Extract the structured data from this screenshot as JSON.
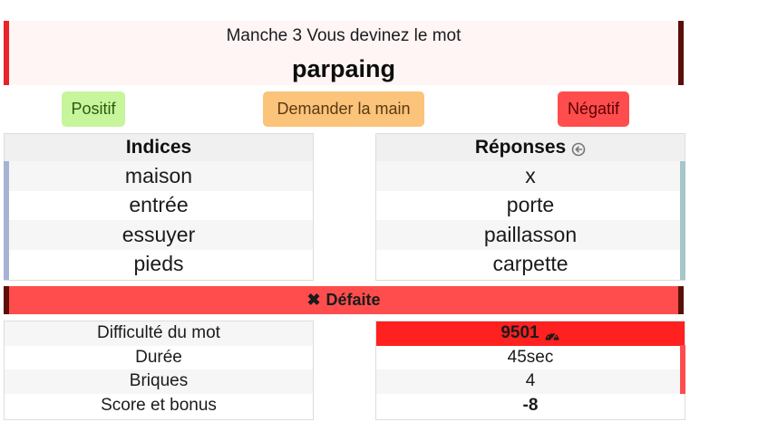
{
  "header": {
    "round_text": "Manche 3 Vous devinez le mot",
    "word": "parpaing"
  },
  "buttons": {
    "positive": "Positif",
    "ask_hand": "Demander la main",
    "negative": "Négatif"
  },
  "clues": {
    "title": "Indices",
    "items": [
      "maison",
      "entrée",
      "essuyer",
      "pieds"
    ]
  },
  "answers": {
    "title": "Réponses",
    "title_icon": "back-arrow-circle-icon",
    "items": [
      "x",
      "porte",
      "paillasson",
      "carpette"
    ]
  },
  "result": {
    "icon": "x-icon",
    "label": "Défaite"
  },
  "stats": {
    "labels": [
      "Difficulté du mot",
      "Durée",
      "Briques",
      "Score et bonus"
    ],
    "difficulty": "9501",
    "difficulty_icon": "gauge-icon",
    "duration": "45sec",
    "bricks": "4",
    "score": "-8"
  },
  "colors": {
    "accent_red": "#ff4d4d",
    "dark_red": "#5a0f08",
    "positive_green": "#c6f59b",
    "hand_orange": "#fcc37a",
    "difficulty_red": "#ff2020",
    "clue_bar": "#a8b3d3",
    "answer_bar": "#a6c6c9"
  }
}
